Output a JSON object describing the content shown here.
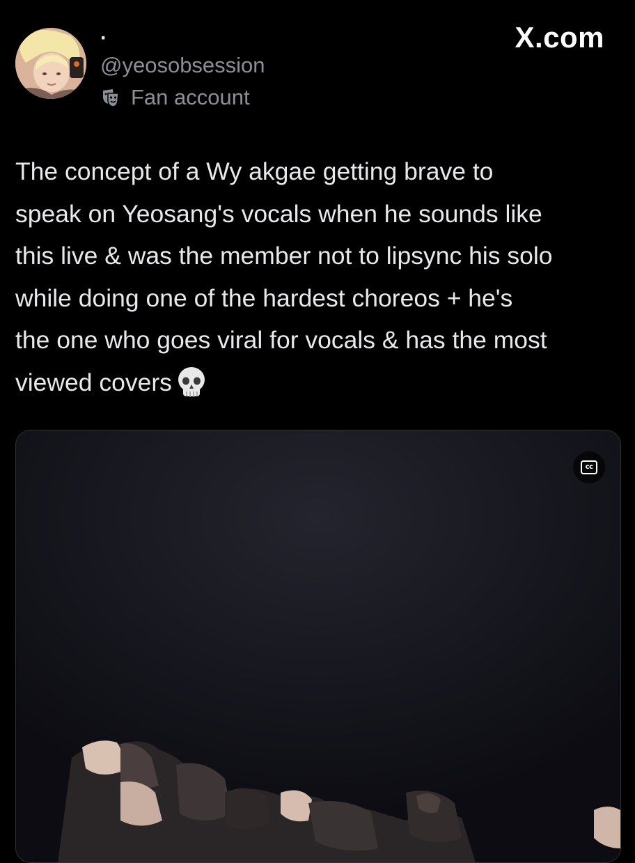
{
  "author": {
    "display_name": "·",
    "handle": "@yeosobsession",
    "badge_label": "Fan account",
    "badge_icon": "theater-masks-icon",
    "avatar": "profile-photo"
  },
  "site": {
    "label": "X.com"
  },
  "tweet": {
    "text": "The concept of a Wy akgae getting brave to\nspeak on Yeosang's vocals when he sounds like\nthis live & was the member not to lipsync his solo\nwhile doing one of the hardest choreos + he's\nthe one who goes viral for vocals & has the most\nviewed covers",
    "emoji": "skull-emoji"
  },
  "media": {
    "type": "video",
    "caption_toggle_label": "cc",
    "caption_icon": "closed-captions-icon"
  },
  "colors": {
    "background": "#000000",
    "text_primary": "#e7e9ea",
    "text_secondary": "#8b9096",
    "border": "#2f3336"
  }
}
